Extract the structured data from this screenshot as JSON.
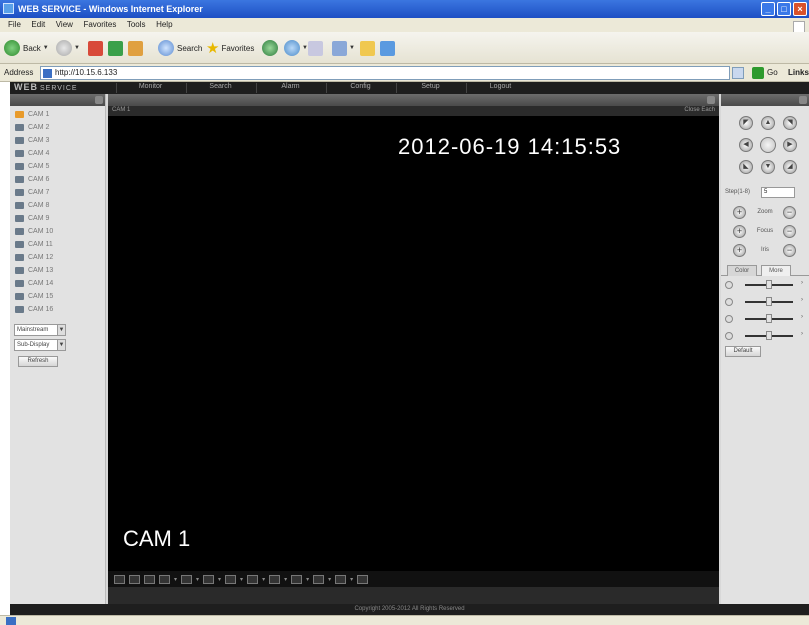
{
  "window": {
    "title": "WEB SERVICE - Windows Internet Explorer"
  },
  "menu": [
    "File",
    "Edit",
    "View",
    "Favorites",
    "Tools",
    "Help"
  ],
  "toolbar": {
    "back": "Back",
    "search": "Search",
    "favorites": "Favorites"
  },
  "address": {
    "label": "Address",
    "url": "http://10.15.6.133",
    "go": "Go",
    "links": "Links"
  },
  "app": {
    "logo": "WEB",
    "logo_sub": "SERVICE",
    "nav": [
      "Monitor",
      "Search",
      "Alarm",
      "Config",
      "Setup",
      "Logout"
    ],
    "channels": [
      "CAM 1",
      "CAM 2",
      "CAM 3",
      "CAM 4",
      "CAM 5",
      "CAM 6",
      "CAM 7",
      "CAM 8",
      "CAM 9",
      "CAM 10",
      "CAM 11",
      "CAM 12",
      "CAM 13",
      "CAM 14",
      "CAM 15",
      "CAM 16"
    ],
    "stream_select": "Mainstream",
    "mode_select": "Sub-Display",
    "refresh_button": "Refresh",
    "video": {
      "channel_name": "CAM 1",
      "close_label": "Close Each",
      "osd_time": "2012-06-19 14:15:53",
      "osd_cam": "CAM 1"
    },
    "ptz": {
      "step_label": "Step(1-8)",
      "step_value": "5",
      "zoom_label": "Zoom",
      "focus_label": "Focus",
      "iris_label": "Iris"
    },
    "tabs": [
      "Color",
      "More"
    ],
    "sliders": [
      {
        "name": "brightness",
        "level": 0.5
      },
      {
        "name": "contrast",
        "level": 0.5
      },
      {
        "name": "saturation",
        "level": 0.5
      },
      {
        "name": "hue",
        "level": 0.5
      }
    ],
    "default_button": "Default",
    "copyright": "Copyright 2005-2012 All Rights Reserved"
  },
  "colors": {
    "title_bar": "#1d4fc4",
    "video_bg": "#000000",
    "panel_header": "#4a4a4a",
    "active_channel_icon": "#e89a2a"
  }
}
